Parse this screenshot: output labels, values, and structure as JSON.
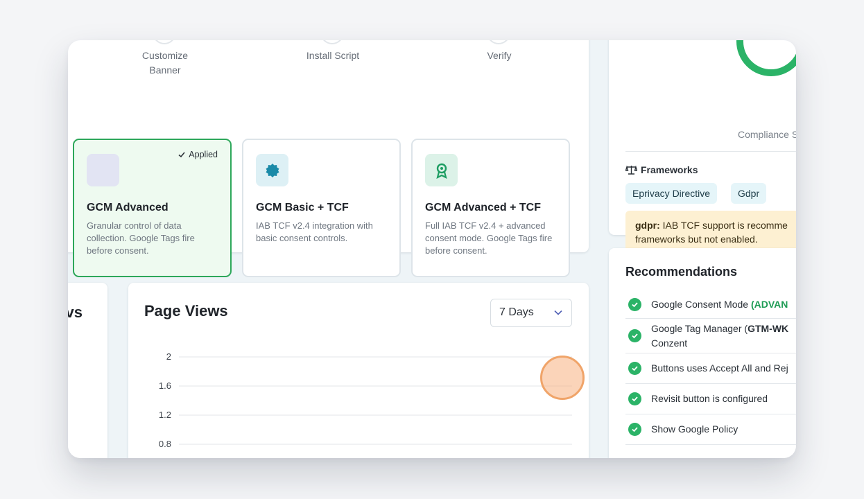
{
  "steps": [
    {
      "label": "Customize\nBanner"
    },
    {
      "label": "Install Script"
    },
    {
      "label": "Verify"
    }
  ],
  "modes": [
    {
      "title": "GCM Advanced",
      "desc": "Granular control of data collection. Google Tags fire before consent.",
      "badge": "Applied",
      "icon": "blank-icon",
      "icon_bg": "#e2e4f3"
    },
    {
      "title": "GCM Basic + TCF",
      "desc": "IAB TCF v2.4 integration with basic consent controls.",
      "icon": "badge-seal-icon",
      "icon_bg": "#ddf0f5"
    },
    {
      "title": "GCM Advanced + TCF",
      "desc": "Full IAB TCF v2.4 + advanced consent mode. Google Tags fire before consent.",
      "icon": "award-icon",
      "icon_bg": "#dcf2e8"
    }
  ],
  "compliance": {
    "score_label": "Compliance S",
    "frameworks_title": "Frameworks",
    "tags": [
      "Eprivacy Directive",
      "Gdpr"
    ],
    "warning_key": "gdpr:",
    "warning_text": " IAB TCF support is recomme",
    "warning_text2": "frameworks but not enabled."
  },
  "left_card": {
    "title_partial": "vs"
  },
  "page_views": {
    "title": "Page Views",
    "range_select": "7 Days"
  },
  "chart_data": {
    "type": "line",
    "title": "Page Views",
    "y_ticks": [
      "2",
      "1.6",
      "1.2",
      "0.8"
    ],
    "ylim": [
      0.8,
      2
    ],
    "series": []
  },
  "recommendations": {
    "title": "Recommendations",
    "items": [
      {
        "text": "Google Consent Mode ",
        "bold": "(ADVAN"
      },
      {
        "text": "Google Tag Manager (",
        "bold": "GTM-WK",
        "text2": "Conzent"
      },
      {
        "text": "Buttons uses Accept All and Rej"
      },
      {
        "text": "Revisit button is configured"
      },
      {
        "text": "Show Google Policy"
      }
    ]
  }
}
